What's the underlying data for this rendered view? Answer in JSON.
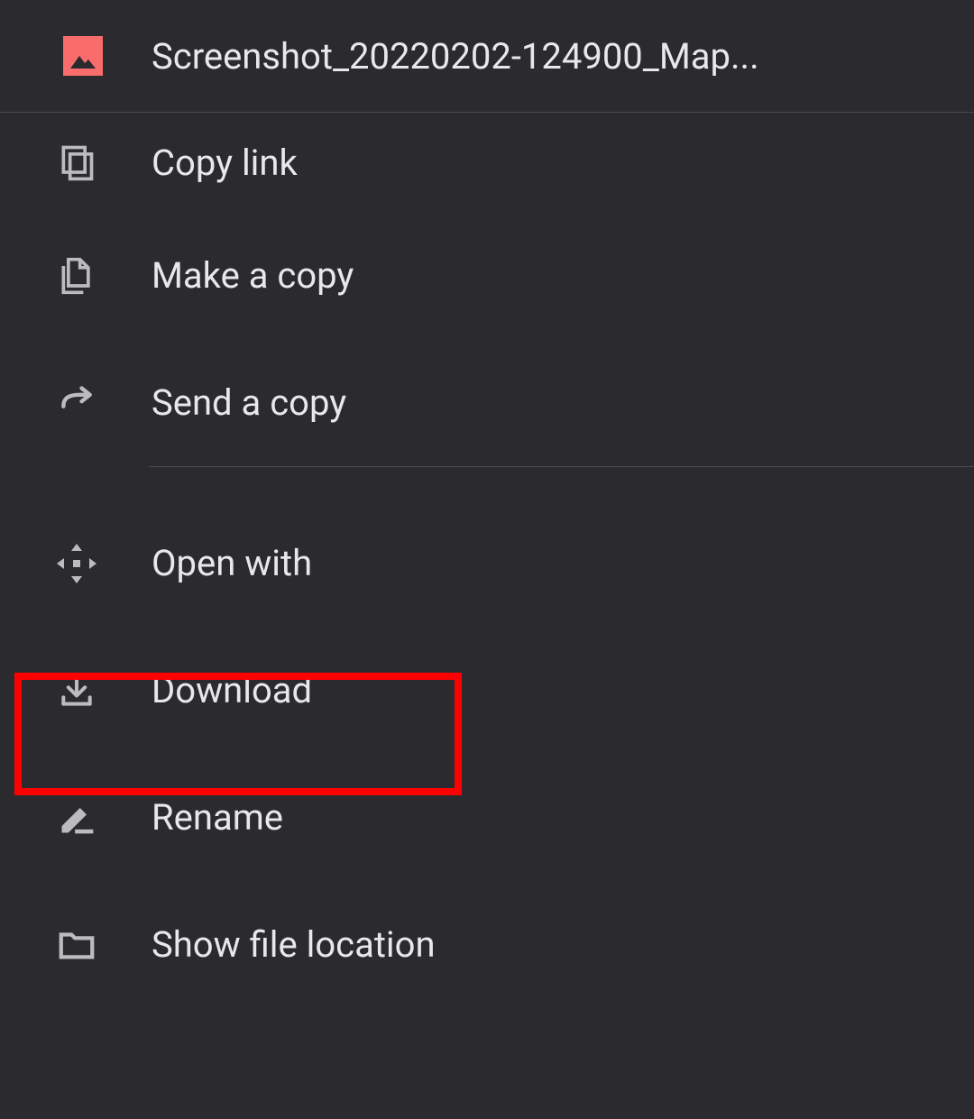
{
  "header": {
    "filename": "Screenshot_20220202-124900_Map..."
  },
  "menu": {
    "copy_link": "Copy link",
    "make_a_copy": "Make a copy",
    "send_a_copy": "Send a copy",
    "open_with": "Open with",
    "download": "Download",
    "rename": "Rename",
    "show_file_location": "Show file location"
  },
  "highlight": {
    "target": "download"
  }
}
